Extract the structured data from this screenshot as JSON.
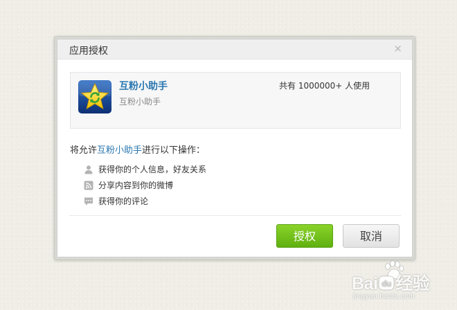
{
  "dialog": {
    "title": "应用授权",
    "close_glyph": "×"
  },
  "app": {
    "name": "互粉小助手",
    "subname": "互粉小助手",
    "usage": "共有 1000000+ 人使用",
    "icon": "star-icon"
  },
  "permissions": {
    "intro_prefix": "将允许",
    "intro_app": "互粉小助手",
    "intro_suffix": "进行以下操作：",
    "items": [
      {
        "label": "获得你的个人信息，好友关系",
        "icon": "user-icon"
      },
      {
        "label": "分享内容到你的微博",
        "icon": "rss-icon"
      },
      {
        "label": "获得你的评论",
        "icon": "comment-icon"
      }
    ]
  },
  "buttons": {
    "authorize": "授权",
    "cancel": "取消"
  },
  "watermark": {
    "brand_left": "Bai",
    "brand_right": "经验",
    "domain": "jingyan.baidu.com"
  },
  "colors": {
    "link": "#2a77b0",
    "authorize_green": "#6cc11c",
    "background": "#efede6"
  }
}
